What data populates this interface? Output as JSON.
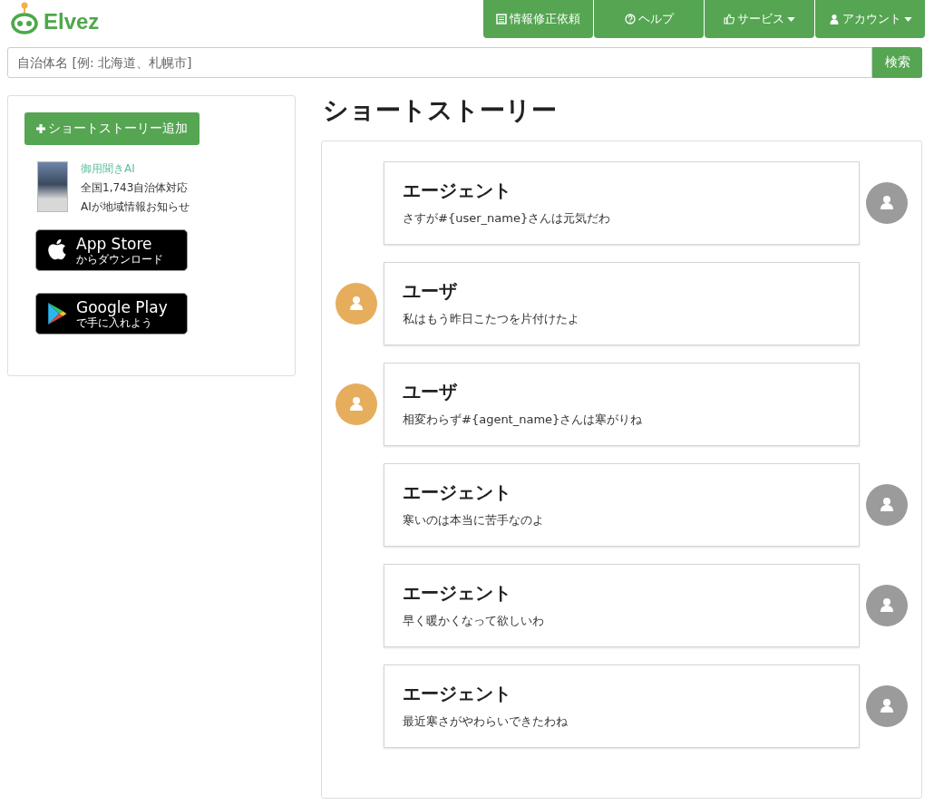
{
  "header": {
    "logo": "Elvez",
    "nav": [
      {
        "label": "情報修正依頼",
        "kind": "document",
        "dropdown": false
      },
      {
        "label": "ヘルプ",
        "kind": "help",
        "dropdown": false
      },
      {
        "label": "サービス",
        "kind": "service",
        "dropdown": true
      },
      {
        "label": "アカウント",
        "kind": "account",
        "dropdown": true
      }
    ]
  },
  "search": {
    "placeholder": "自治体名 [例: 北海道、札幌市]",
    "button": "検索"
  },
  "sidebar": {
    "add_button": "ショートストーリー追加",
    "app": {
      "name": "御用聞きAI",
      "lines": [
        "全国1,743自治体対応",
        "AIが地域情報お知らせ"
      ]
    },
    "stores": [
      {
        "kind": "apple",
        "title": "App Store",
        "subtitle": "からダウンロード"
      },
      {
        "kind": "google",
        "title": "Google Play",
        "subtitle": "で手に入れよう"
      }
    ]
  },
  "page_title": "ショートストーリー",
  "messages": [
    {
      "kind": "agent",
      "speaker": "エージェント",
      "text": "さすが#{user_name}さんは元気だわ"
    },
    {
      "kind": "user",
      "speaker": "ユーザ",
      "text": "私はもう昨日こたつを片付けたよ"
    },
    {
      "kind": "user",
      "speaker": "ユーザ",
      "text": "相変わらず#{agent_name}さんは寒がりね"
    },
    {
      "kind": "agent",
      "speaker": "エージェント",
      "text": "寒いのは本当に苦手なのよ"
    },
    {
      "kind": "agent",
      "speaker": "エージェント",
      "text": "早く暖かくなって欲しいわ"
    },
    {
      "kind": "agent",
      "speaker": "エージェント",
      "text": "最近寒さがやわらいできたわね"
    }
  ]
}
